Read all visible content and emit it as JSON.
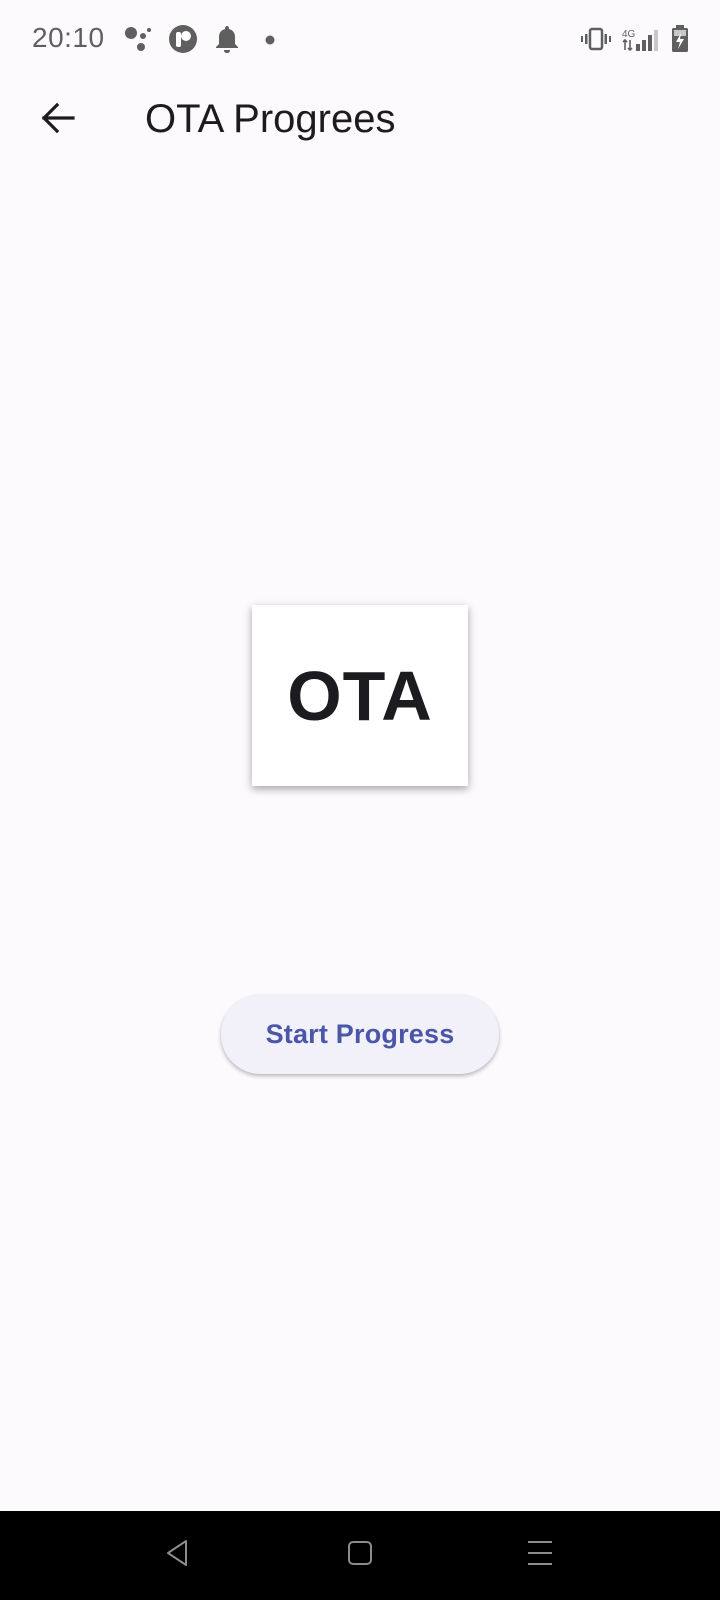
{
  "status_bar": {
    "time": "20:10",
    "network": "4G",
    "icons": [
      "assistant-dots-icon",
      "app-p-icon",
      "bell-icon",
      "dot-icon",
      "vibrate-icon",
      "signal-icon",
      "battery-charging-icon"
    ]
  },
  "app_bar": {
    "back_icon": "arrow-left-icon",
    "title": "OTA Progrees"
  },
  "main": {
    "card_text": "OTA",
    "start_button_label": "Start Progress"
  },
  "nav_bar": {
    "icons": [
      "back-triangle-icon",
      "home-square-icon",
      "menu-lines-icon"
    ]
  },
  "colors": {
    "background": "#fcfafd",
    "button_bg": "#f2f0f9",
    "button_text": "#4a56a8",
    "nav_bar": "#000000"
  }
}
